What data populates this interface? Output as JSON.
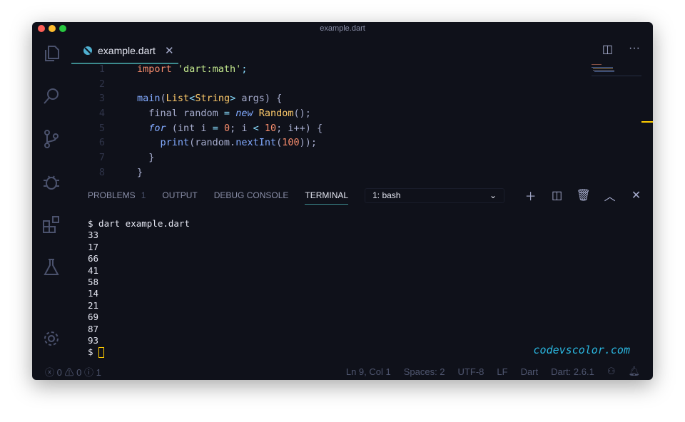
{
  "window": {
    "title": "example.dart"
  },
  "activity_bar": [
    "files-icon",
    "search-icon",
    "source-control-icon",
    "debug-icon",
    "extensions-icon",
    "testing-icon",
    "settings-gear-icon"
  ],
  "tab": {
    "label": "example.dart",
    "icon": "dart-icon"
  },
  "code": [
    {
      "n": "1",
      "tokens": [
        [
          "import ",
          "k"
        ],
        [
          "'dart:math'",
          "s"
        ],
        [
          ";",
          "o"
        ]
      ]
    },
    {
      "n": "2",
      "tokens": []
    },
    {
      "n": "3",
      "tokens": [
        [
          "main",
          "f"
        ],
        [
          "(",
          "p"
        ],
        [
          "List",
          "t"
        ],
        [
          "<",
          "o"
        ],
        [
          "String",
          "t"
        ],
        [
          "> ",
          "o"
        ],
        [
          "args) {",
          "p"
        ]
      ]
    },
    {
      "n": "4",
      "tokens": [
        [
          "  final random ",
          "p"
        ],
        [
          "= ",
          "o"
        ],
        [
          "new ",
          "i"
        ],
        [
          "Random",
          "t"
        ],
        [
          "();",
          "p"
        ]
      ]
    },
    {
      "n": "5",
      "tokens": [
        [
          "  for ",
          "i"
        ],
        [
          "(int i ",
          "p"
        ],
        [
          "= ",
          "o"
        ],
        [
          "0",
          "n"
        ],
        [
          "; i ",
          "p"
        ],
        [
          "< ",
          "o"
        ],
        [
          "10",
          "n"
        ],
        [
          "; i++) {",
          "p"
        ]
      ]
    },
    {
      "n": "6",
      "tokens": [
        [
          "    print",
          "f"
        ],
        [
          "(random.",
          "p"
        ],
        [
          "nextInt",
          "f"
        ],
        [
          "(",
          "p"
        ],
        [
          "100",
          "n"
        ],
        [
          "));",
          "p"
        ]
      ]
    },
    {
      "n": "7",
      "tokens": [
        [
          "  }",
          "p"
        ]
      ]
    },
    {
      "n": "8",
      "tokens": [
        [
          "}",
          "p"
        ]
      ]
    }
  ],
  "panel": {
    "tabs": [
      "PROBLEMS",
      "OUTPUT",
      "DEBUG CONSOLE",
      "TERMINAL"
    ],
    "problems_count": "1",
    "active": "TERMINAL",
    "terminal_select": "1: bash"
  },
  "terminal": {
    "lines": [
      "$ dart example.dart",
      "33",
      "17",
      "66",
      "41",
      "58",
      "14",
      "21",
      "69",
      "87",
      "93"
    ],
    "prompt": "$"
  },
  "watermark": "codevscolor.com",
  "status": {
    "errors": "0",
    "warnings": "0",
    "info": "1",
    "position": "Ln 9, Col 1",
    "spaces": "Spaces: 2",
    "encoding": "UTF-8",
    "eol": "LF",
    "language": "Dart",
    "sdk": "Dart: 2.6.1"
  },
  "colors": {
    "background": "#0f111a",
    "accent": "#3c8b8e",
    "cursor": "#ffcc00"
  }
}
